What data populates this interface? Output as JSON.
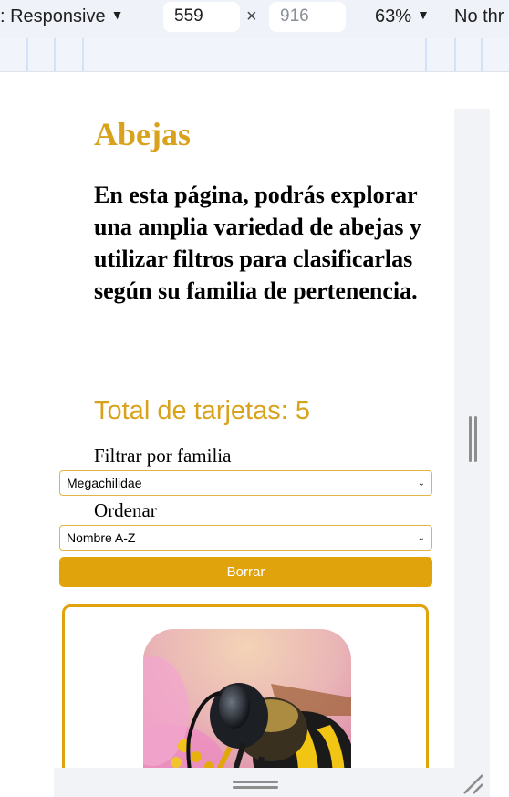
{
  "devtools": {
    "device_label": ": Responsive",
    "width_value": "559",
    "height_placeholder": "916",
    "times_sign": "×",
    "zoom": "63%",
    "throttling": "No thr"
  },
  "page": {
    "title": "Abejas",
    "intro": "En esta página, podrás explorar una amplia variedad de abejas y utilizar filtros para clasificarlas según su familia de pertenencia.",
    "total_label": "Total de tarjetas: 5",
    "filter_label": "Filtrar por familia",
    "filter_selected": "Megachilidae",
    "sort_label": "Ordenar",
    "sort_selected": "Nombre A-Z",
    "clear_button": "Borrar"
  },
  "colors": {
    "accent": "#d9a21c",
    "button": "#e0a30b"
  },
  "icons": {
    "dropdown": "chevron-down-icon",
    "caret": "caret-down-icon",
    "resize": "resize-grip-icon"
  }
}
